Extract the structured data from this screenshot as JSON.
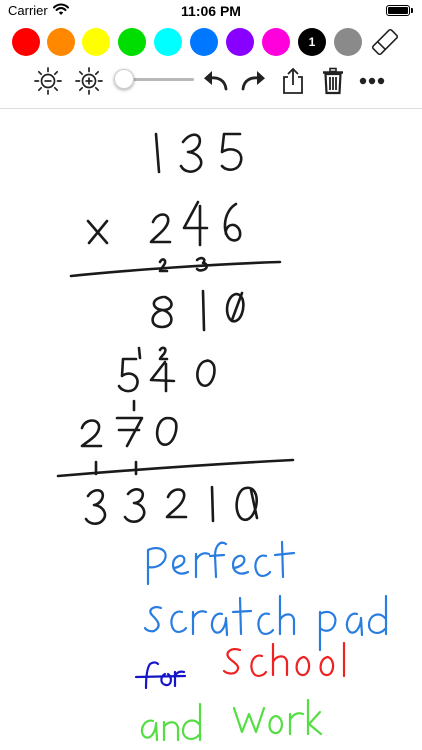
{
  "status_bar": {
    "carrier": "Carrier",
    "time": "11:06 PM"
  },
  "palette": {
    "colors": [
      "#ff0000",
      "#ff8800",
      "#ffff00",
      "#00dd00",
      "#00ffff",
      "#0077ff",
      "#8800ff",
      "#ff00dd",
      "#000000",
      "#8a8a8a"
    ],
    "selected_index": 8,
    "selected_label": "1"
  },
  "toolbar": {
    "icons": [
      "brightness-down-icon",
      "brightness-up-icon",
      "undo-icon",
      "redo-icon",
      "share-icon",
      "trash-icon",
      "more-icon",
      "eraser-icon"
    ],
    "brush_size": 0
  },
  "drawing": {
    "ink_colors": {
      "black": "#1a1a1a",
      "blue": "#2a7de0",
      "red": "#ee2222",
      "navy": "#1515c8",
      "green": "#55dd44"
    }
  }
}
